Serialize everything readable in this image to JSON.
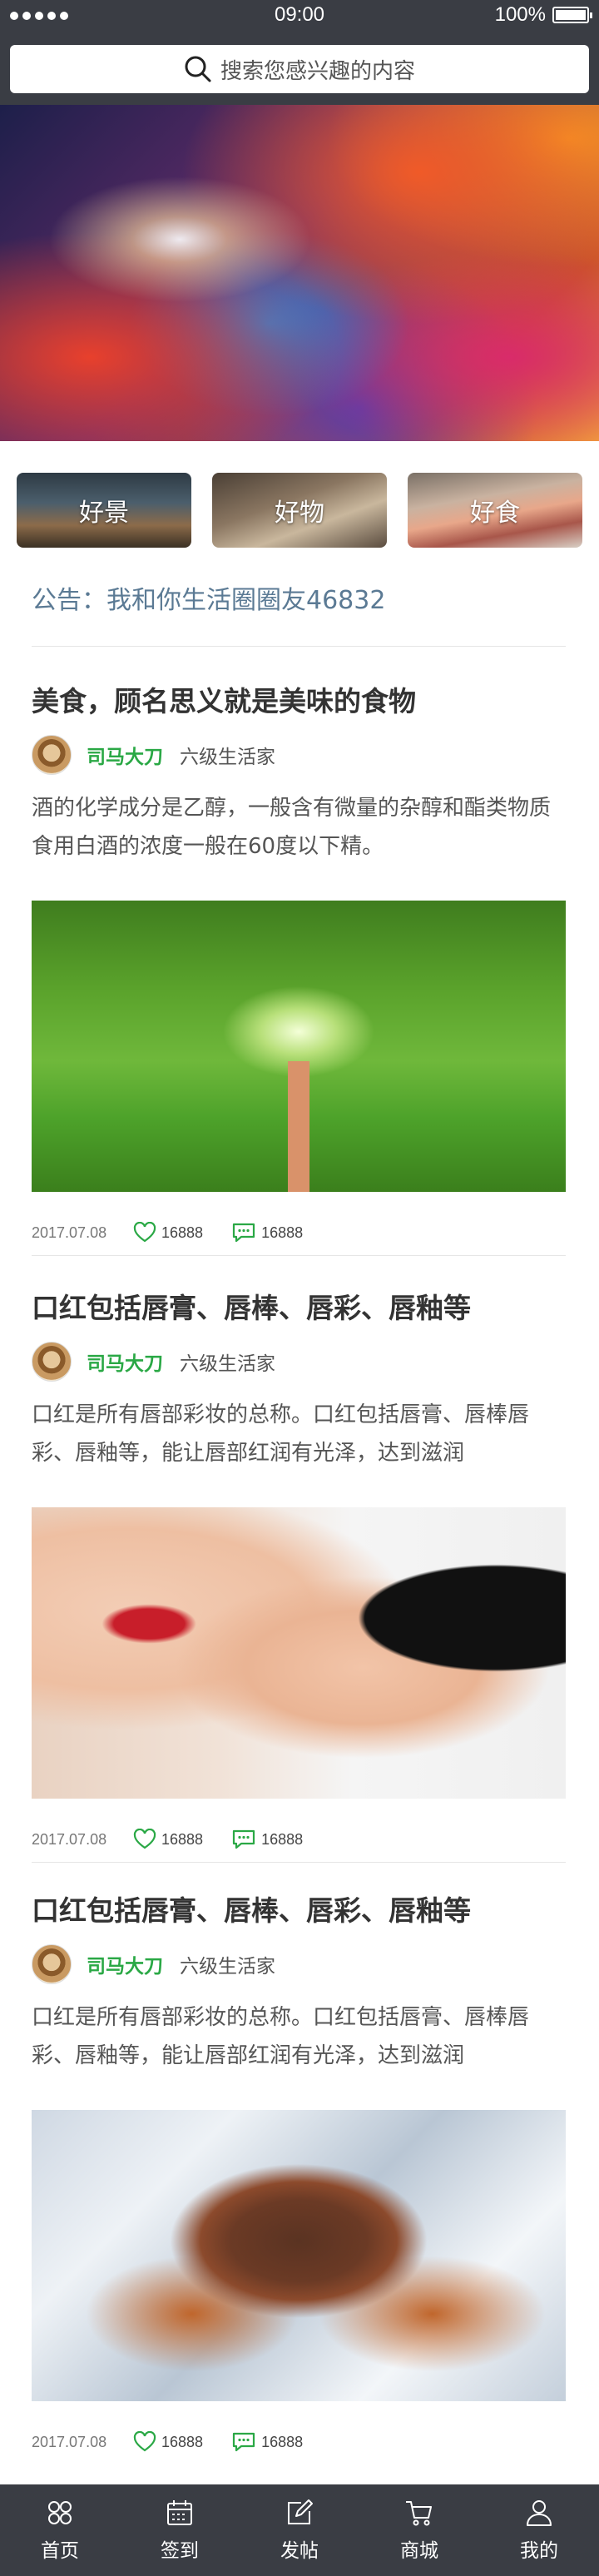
{
  "status_bar": {
    "time": "09:00",
    "battery": "100%"
  },
  "search": {
    "icon": "search-icon",
    "placeholder": "搜索您感兴趣的内容"
  },
  "categories": [
    {
      "label": "好景"
    },
    {
      "label": "好物"
    },
    {
      "label": "好食"
    }
  ],
  "notice": {
    "text": "公告：我和你生活圈圈友46832"
  },
  "articles": [
    {
      "title": "美食，顾名思义就是美味的食物",
      "author": "司马大刀",
      "level": "六级生活家",
      "excerpt": "酒的化学成分是乙醇，一般含有微量的杂醇和酯类物质食用白酒的浓度一般在60度以下精。",
      "date": "2017.07.08",
      "likes": "16888",
      "comments": "16888",
      "image": "tree-lined-path-photo"
    },
    {
      "title": "口红包括唇膏、唇棒、唇彩、唇釉等",
      "author": "司马大刀",
      "level": "六级生活家",
      "excerpt": "口红是所有唇部彩妆的总称。口红包括唇膏、唇棒唇彩、唇釉等，能让唇部红润有光泽，达到滋润",
      "date": "2017.07.08",
      "likes": "16888",
      "comments": "16888",
      "image": "lipstick-photo"
    },
    {
      "title": "口红包括唇膏、唇棒、唇彩、唇釉等",
      "author": "司马大刀",
      "level": "六级生活家",
      "excerpt": "口红是所有唇部彩妆的总称。口红包括唇膏、唇棒唇彩、唇釉等，能让唇部红润有光泽，达到滋润",
      "date": "2017.07.08",
      "likes": "16888",
      "comments": "16888",
      "image": "crab-on-ice-photo"
    }
  ],
  "tabbar": [
    {
      "label": "首页",
      "icon": "home-icon"
    },
    {
      "label": "签到",
      "icon": "calendar-icon"
    },
    {
      "label": "发帖",
      "icon": "edit-icon"
    },
    {
      "label": "商城",
      "icon": "cart-icon"
    },
    {
      "label": "我的",
      "icon": "user-icon"
    }
  ],
  "colors": {
    "header_bg": "#3a3d44",
    "author": "#2aa845",
    "notice": "#5b7a94"
  }
}
